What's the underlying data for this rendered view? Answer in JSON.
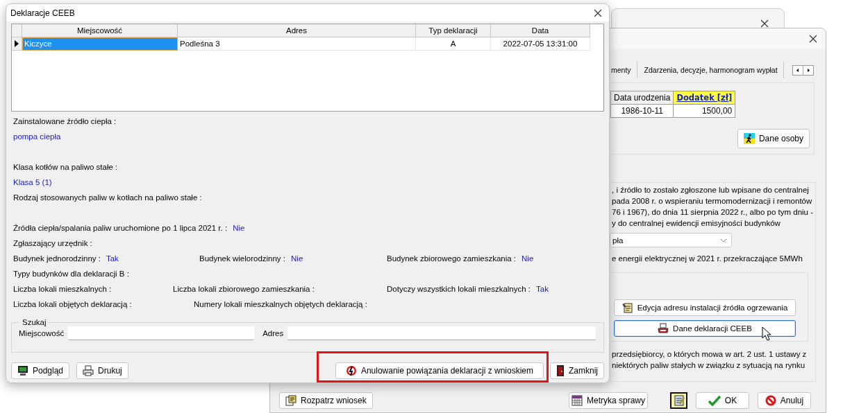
{
  "main_window": {
    "tabs": [
      {
        "label": "menty"
      },
      {
        "label": "Zdarzenia, decyzje, harmonogram wypłat"
      }
    ],
    "people_table": {
      "columns": [
        {
          "label": "Data urodzenia",
          "highlighted": false
        },
        {
          "label": "Dodatek  [zł]",
          "highlighted": true
        }
      ],
      "rows": [
        [
          "1986-10-11",
          "1500,00"
        ]
      ]
    },
    "person_button": "Dane osoby",
    "eligibility_text": [
      ", i źródło to zostało zgłoszone lub wpisane do centralnej",
      "pada 2008 r. o wspieraniu termomodernizacji i remontów",
      "76 i 1967), do dnia 11 sierpnia 2022 r., albo po tym dniu -",
      "y do centralnej ewidencji emisyjności budynków"
    ],
    "heat_source_select": {
      "value": "pła"
    },
    "energy_text": "e energii elektrycznej w 2021 r. przekraczające 5MWh",
    "address_button": "Edycja adresu instalacji źródła ogrzewania",
    "ceeb_button": {
      "label": "Dane deklaracji CEEB",
      "focused": true
    },
    "business_text": [
      "przedsiębiorcy, o których mowa w art. 2 ust. 1 ustawy z",
      "niektórych paliw stałych w związku z sytuacją na rynku"
    ],
    "footer_buttons": [
      {
        "label": "Rozpatrz wniosek",
        "kind": "review"
      },
      {
        "label": "Metryka sprawy",
        "kind": "record"
      },
      {
        "kind": "notes"
      },
      {
        "label": "OK",
        "kind": "ok"
      },
      {
        "label": "Anuluj",
        "kind": "cancel"
      }
    ]
  },
  "dialog": {
    "title": "Deklaracje CEEB",
    "grid": {
      "columns": [
        "Miejscowość",
        "Adres",
        "Typ deklaracji",
        "Data"
      ],
      "rows": [
        {
          "cells": [
            "Kiczyce",
            "Podleśna 3",
            "A",
            "2022-07-05 13:31:00"
          ],
          "selected": true
        }
      ]
    },
    "details": [
      {
        "kind": "stacked",
        "label": "Zainstalowane źródło ciepła :",
        "value": "pompa ciepła"
      },
      {
        "kind": "stacked",
        "label": "Klasa kotłów na paliwo stałe :",
        "value": "Klasa 5 (1)"
      },
      {
        "kind": "stacked",
        "label": "Rodzaj stosowanych paliw w kotłach na paliwo stałe :"
      },
      {
        "kind": "row",
        "items": [
          {
            "label": "Źródła ciepła/spalania paliw uruchomione po 1 lipca 2021 r. :",
            "value": "Nie"
          }
        ]
      },
      {
        "kind": "row",
        "items": [
          {
            "label": "Zgłaszający urzędnik :"
          }
        ]
      },
      {
        "kind": "row",
        "items": [
          {
            "label": "Budynek jednorodzinny :",
            "value": "Tak"
          },
          {
            "label": "Budynek wielorodzinny :",
            "value": "Nie"
          },
          {
            "label": "Budynek zbiorowego zamieszkania :",
            "value": "Nie"
          }
        ]
      },
      {
        "kind": "row",
        "items": [
          {
            "label": "Typy budynków dla deklaracji B :"
          }
        ]
      },
      {
        "kind": "row",
        "items": [
          {
            "label": "Liczba lokali mieszkalnych :"
          },
          {
            "label": "Liczba lokali zbiorowego zamieszkania :"
          },
          {
            "label": "Dotyczy wszystkich lokali mieszkalnych :",
            "value": "Tak"
          }
        ]
      },
      {
        "kind": "row",
        "items": [
          {
            "label": "Liczba lokali objętych deklaracją :"
          },
          {
            "label": "Numery lokali mieszkalnych objętych deklaracją :"
          }
        ]
      }
    ],
    "search": {
      "title": "Szukaj",
      "fields": [
        {
          "label": "Miejscowość"
        },
        {
          "label": "Adres"
        }
      ]
    },
    "buttons": [
      {
        "label": "Podgląd",
        "kind": "preview"
      },
      {
        "label": "Drukuj",
        "kind": "print"
      },
      {
        "label": "Anulowanie powiązania deklaracji z wnioskiem",
        "kind": "unlink"
      },
      {
        "label": "Zamknij",
        "kind": "close"
      }
    ]
  }
}
